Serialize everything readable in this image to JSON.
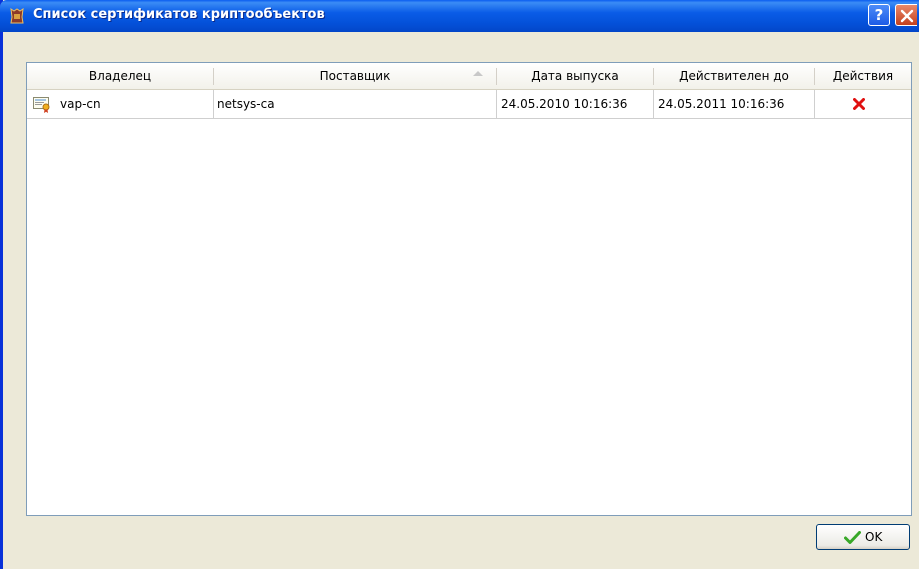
{
  "window": {
    "title": "Список сертификатов криптообъектов",
    "help_label": "?"
  },
  "columns": [
    "Владелец",
    "Поставщик",
    "Дата выпуска",
    "Действителен до",
    "Действия"
  ],
  "sort": {
    "column": "Поставщик",
    "direction": "ascending"
  },
  "rows": [
    {
      "owner": "vap-cn",
      "issuer": "netsys-ca",
      "issued": "24.05.2010 10:16:36",
      "valid_until": "24.05.2011 10:16:36",
      "action_icon": "delete-icon"
    }
  ],
  "buttons": {
    "ok_label": "OK"
  },
  "colors": {
    "title_bar": "#0a5ce7",
    "dialog_bg": "#ece9d8",
    "delete": "#e01010",
    "ok_check": "#38a828"
  }
}
